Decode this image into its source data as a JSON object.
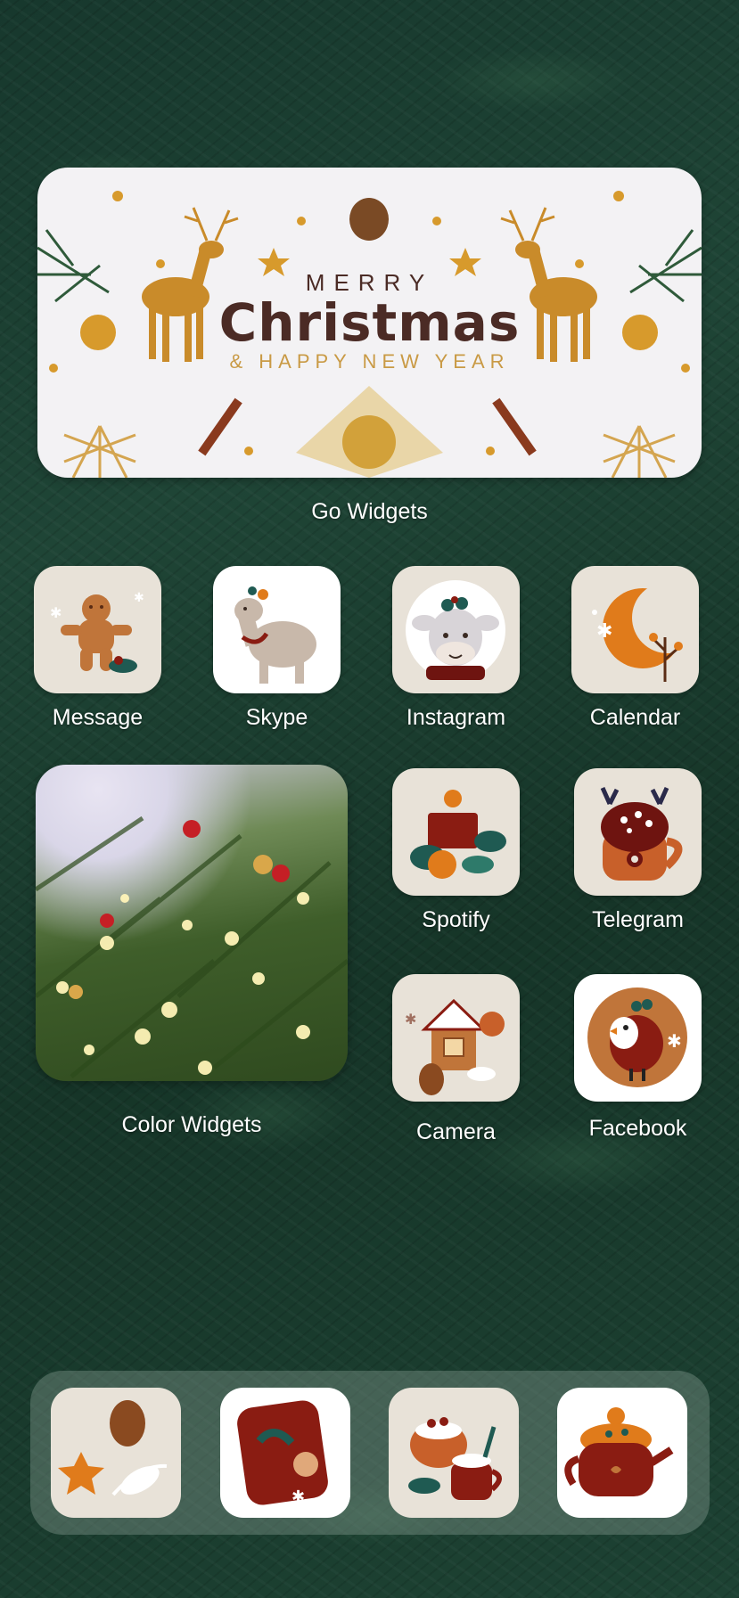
{
  "widgets": {
    "banner": {
      "merry": "MERRY",
      "christmas": "Christmas",
      "new_year": "& HAPPY NEW YEAR",
      "label": "Go Widgets"
    },
    "photo": {
      "label": "Color Widgets"
    }
  },
  "apps": [
    {
      "label": "Message",
      "icon": "gingerbread-man-icon"
    },
    {
      "label": "Skype",
      "icon": "reindeer-icon"
    },
    {
      "label": "Instagram",
      "icon": "cow-icon"
    },
    {
      "label": "Calendar",
      "icon": "crescent-moon-icon"
    },
    {
      "label": "Spotify",
      "icon": "candle-icon"
    },
    {
      "label": "Telegram",
      "icon": "cocoa-mug-icon"
    },
    {
      "label": "Camera",
      "icon": "gingerbread-house-icon"
    },
    {
      "label": "Facebook",
      "icon": "robin-bird-icon"
    }
  ],
  "dock": [
    {
      "icon": "pinecone-cookie-icon"
    },
    {
      "icon": "gift-book-icon"
    },
    {
      "icon": "pudding-mug-icon"
    },
    {
      "icon": "teapot-icon"
    }
  ],
  "colors": {
    "beige_tile": "#e8e2d8",
    "accent_red": "#8a1c12",
    "accent_orange": "#e07b1b",
    "accent_teal": "#1f5a52"
  }
}
